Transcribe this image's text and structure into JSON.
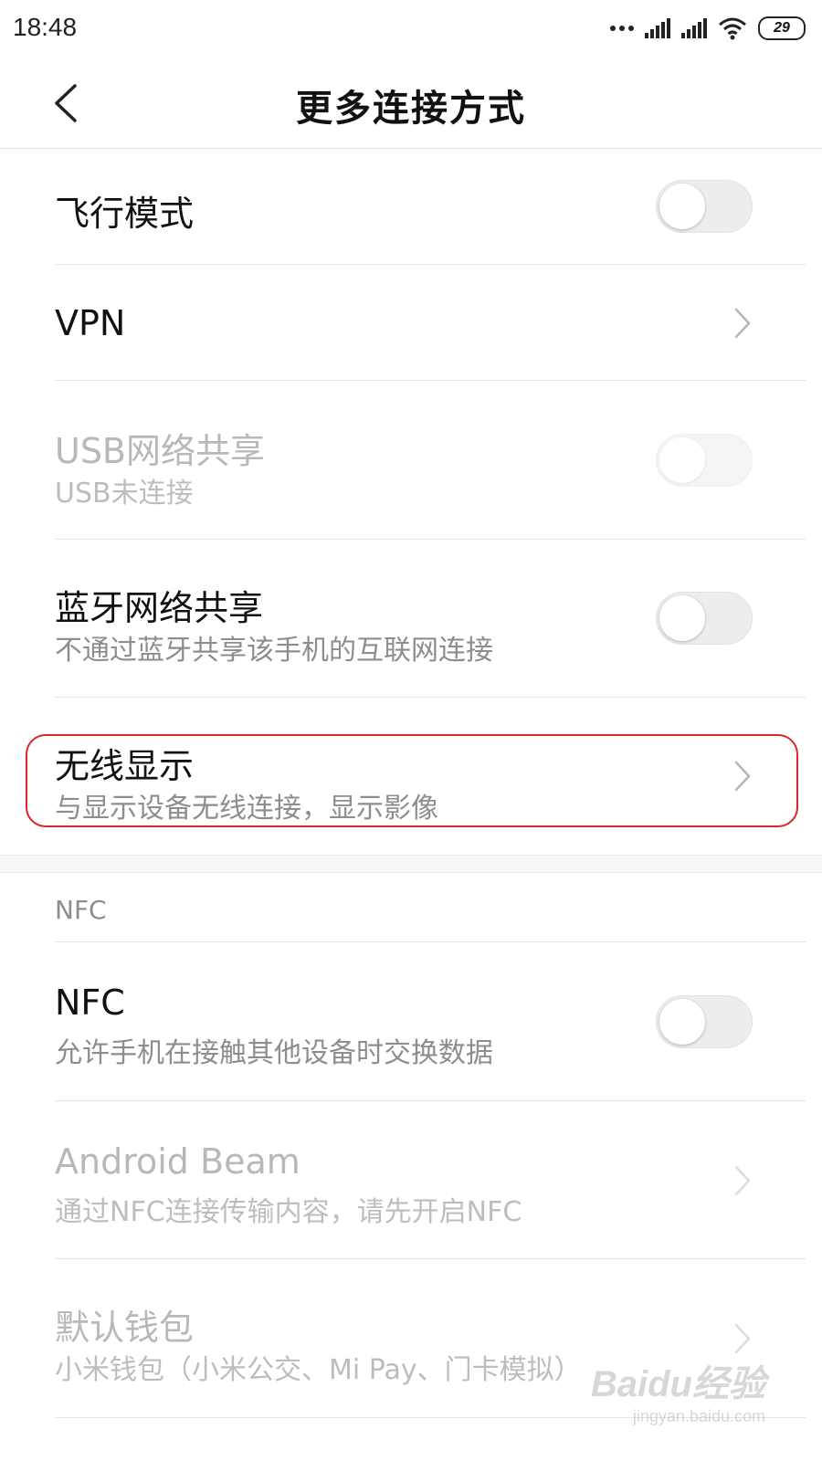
{
  "status_bar": {
    "time": "18:48",
    "battery": "29"
  },
  "header": {
    "title": "更多连接方式",
    "back_icon": "chevron-left-icon"
  },
  "items": [
    {
      "title": "飞行模式",
      "control": "toggle",
      "state": "off",
      "enabled": true
    },
    {
      "title": "VPN",
      "control": "chevron",
      "enabled": true
    },
    {
      "title": "USB网络共享",
      "subtitle": "USB未连接",
      "control": "toggle",
      "state": "off",
      "enabled": false
    },
    {
      "title": "蓝牙网络共享",
      "subtitle": "不通过蓝牙共享该手机的互联网连接",
      "control": "toggle",
      "state": "off",
      "enabled": true
    },
    {
      "title": "无线显示",
      "subtitle": "与显示设备无线连接，显示影像",
      "control": "chevron",
      "enabled": true,
      "highlighted": true
    }
  ],
  "nfc_section": {
    "label": "NFC",
    "items": [
      {
        "title": "NFC",
        "subtitle": "允许手机在接触其他设备时交换数据",
        "control": "toggle",
        "state": "off",
        "enabled": true
      },
      {
        "title": "Android Beam",
        "subtitle": "通过NFC连接传输内容，请先开启NFC",
        "control": "chevron",
        "enabled": false
      },
      {
        "title": "默认钱包",
        "subtitle": "小米钱包（小米公交、Mi Pay、门卡模拟）",
        "control": "chevron",
        "enabled": false
      }
    ]
  },
  "watermark": {
    "main": "Baidu经验",
    "sub": "jingyan.baidu.com"
  },
  "colors": {
    "highlight": "#d9262c",
    "disabled_text": "#b8b8b8",
    "subtitle_text": "#8d8d8d"
  }
}
